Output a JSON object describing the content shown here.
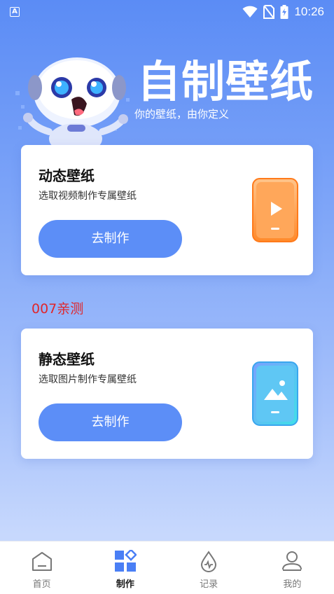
{
  "status_bar": {
    "app_badge": "A",
    "time": "10:26",
    "icons": [
      "wifi-icon",
      "no-sim-icon",
      "battery-charging-icon"
    ]
  },
  "hero": {
    "title": "自制壁纸",
    "subtitle": "你的壁纸，由你定义"
  },
  "cards": [
    {
      "title": "动态壁纸",
      "description": "选取视频制作专属壁纸",
      "button_label": "去制作",
      "icon": "video-phone-icon",
      "accent": "#ff8a2b"
    },
    {
      "title": "静态壁纸",
      "description": "选取图片制作专属壁纸",
      "button_label": "去制作",
      "icon": "image-phone-icon",
      "accent": "#36c9f0"
    }
  ],
  "note": "007亲测",
  "tabs": [
    {
      "label": "首页",
      "icon": "home-icon",
      "active": false
    },
    {
      "label": "制作",
      "icon": "make-icon",
      "active": true
    },
    {
      "label": "记录",
      "icon": "record-icon",
      "active": false
    },
    {
      "label": "我的",
      "icon": "profile-icon",
      "active": false
    }
  ],
  "colors": {
    "primary": "#5c8ef7",
    "background_top": "#5b8cf5",
    "note_red": "#e0262b"
  }
}
